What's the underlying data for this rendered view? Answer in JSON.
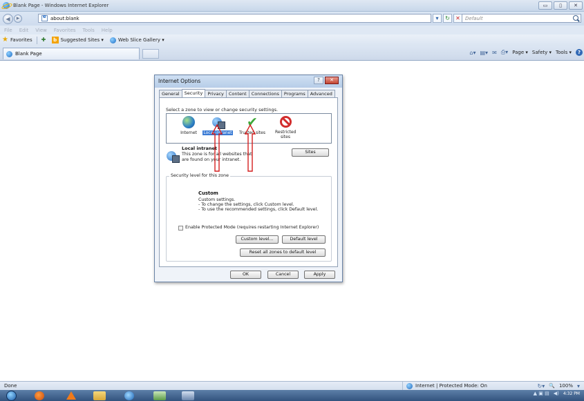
{
  "window": {
    "title": "Blank Page - Windows Internet Explorer",
    "controls": [
      "▭",
      "▯",
      "✕"
    ]
  },
  "addressbar": {
    "url": "about:blank",
    "search_placeholder": "Default"
  },
  "menubar": [
    "File",
    "Edit",
    "View",
    "Favorites",
    "Tools",
    "Help"
  ],
  "favorites_bar": {
    "favorites_label": "Favorites",
    "suggested_sites": "Suggested Sites ▾",
    "web_slice_gallery": "Web Slice Gallery ▾"
  },
  "tab": {
    "label": "Blank Page"
  },
  "command_bar": {
    "page": "Page ▾",
    "safety": "Safety ▾",
    "tools": "Tools ▾"
  },
  "status": {
    "left": "Done",
    "zone": "Internet | Protected Mode: On",
    "zoom": "100%",
    "zoom_icon": "🔍"
  },
  "taskbar": {
    "time": "4:32 PM"
  },
  "dialog": {
    "title": "Internet Options",
    "help_btn": "?",
    "close_btn": "✕",
    "tabs": [
      "General",
      "Security",
      "Privacy",
      "Content",
      "Connections",
      "Programs",
      "Advanced"
    ],
    "select_zone_text": "Select a zone to view or change security settings.",
    "zones": [
      {
        "label": "Internet",
        "icon": "internet-zone-icon"
      },
      {
        "label": "Local intranet",
        "icon": "local-intranet-icon",
        "selected": true
      },
      {
        "label": "Trusted sites",
        "icon": "trusted-sites-icon"
      },
      {
        "label": "Restricted sites",
        "icon": "restricted-sites-icon"
      }
    ],
    "zone_detail": {
      "title": "Local intranet",
      "desc": "This zone is for all websites that are found on your intranet."
    },
    "sites_btn": "Sites",
    "security_group_label": "Security level for this zone",
    "level": {
      "title": "Custom",
      "line1": "Custom settings.",
      "line2": "- To change the settings, click Custom level.",
      "line3": "- To use the recommended settings, click Default level."
    },
    "protected_mode_label": "Enable Protected Mode (requires restarting Internet Explorer)",
    "custom_level_btn": "Custom level...",
    "default_level_btn": "Default level",
    "reset_btn": "Reset all zones to default level",
    "ok_btn": "OK",
    "cancel_btn": "Cancel",
    "apply_btn": "Apply"
  },
  "colors": {
    "annotation_arrow": "#d41e1e",
    "selection": "#3a7bd5"
  }
}
